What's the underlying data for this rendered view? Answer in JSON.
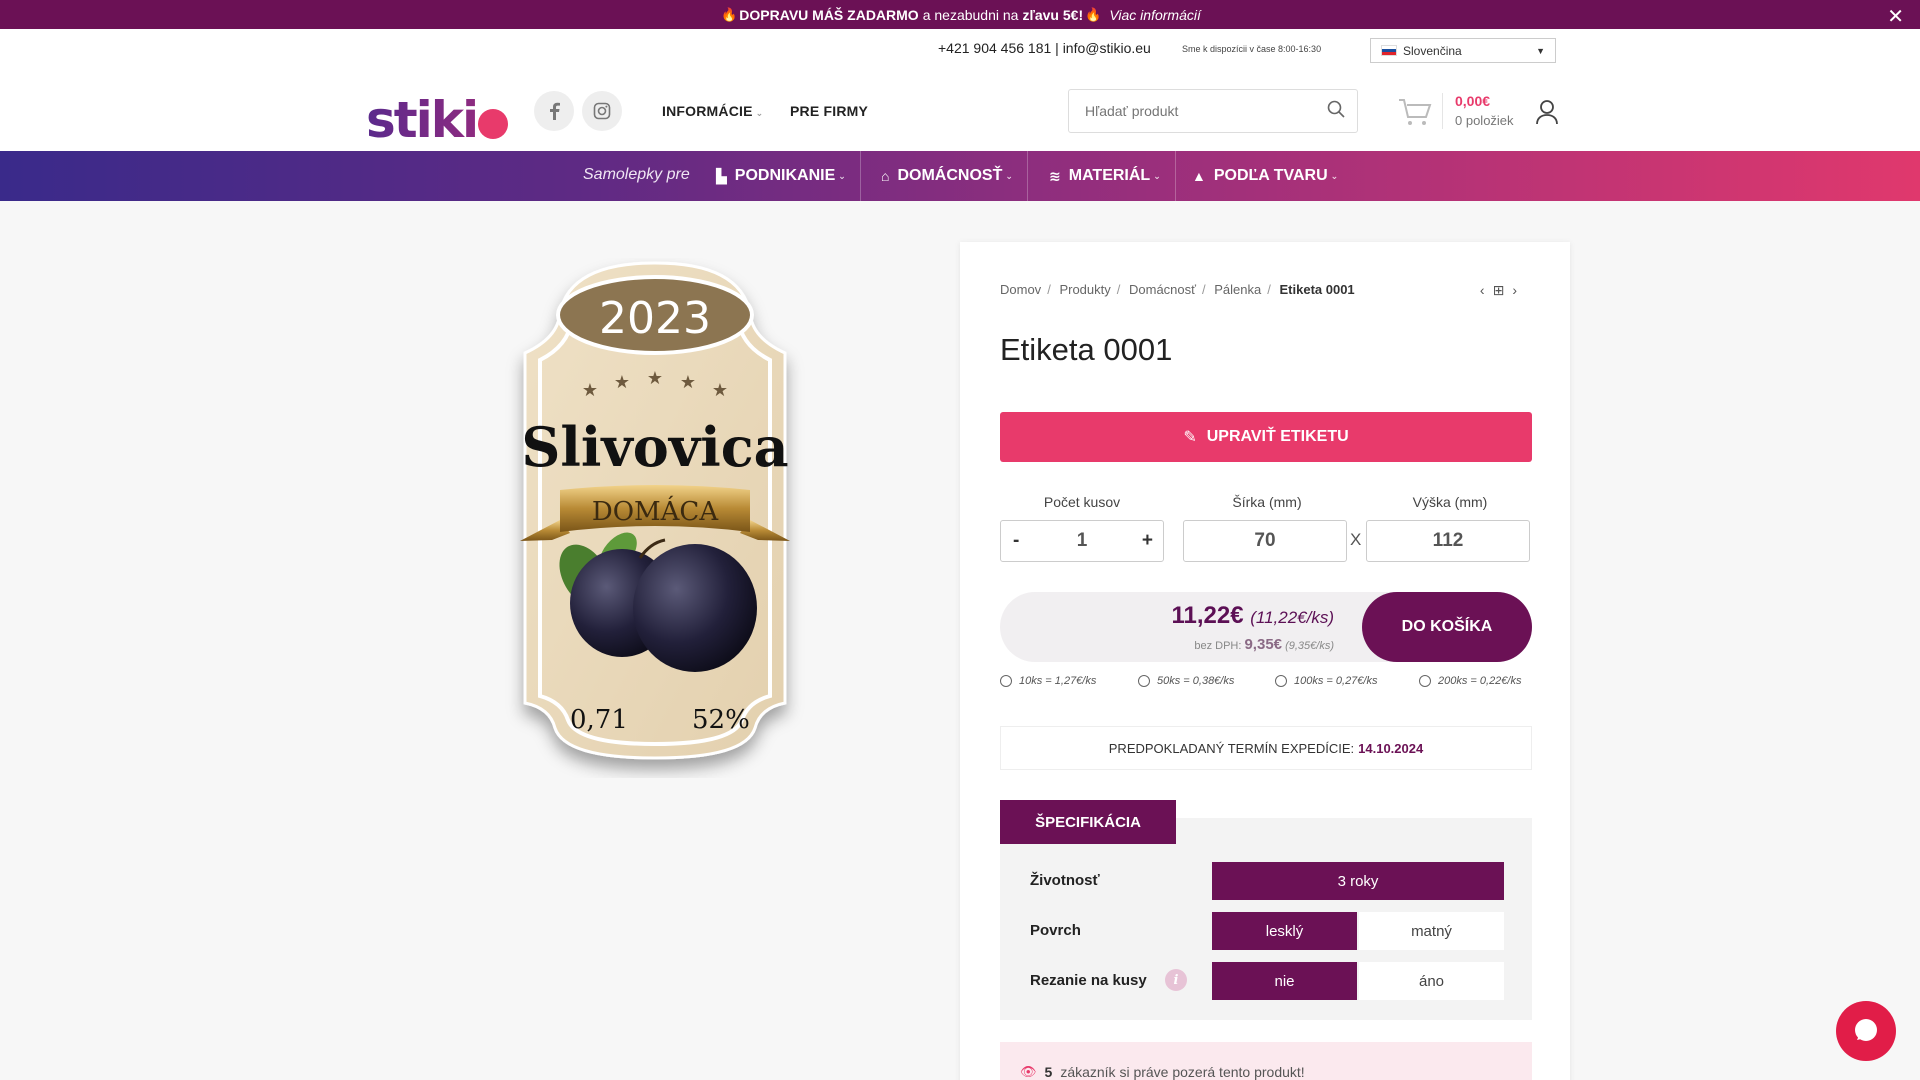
{
  "promo": {
    "bold_text": "DOPRAVU MÁŠ ZADARMO",
    "middle_text": "a nezabudni na",
    "bold_discount": "zľavu 5€!",
    "more_link": "Viac informácií",
    "close_symbol": "✕"
  },
  "header": {
    "contact": "+421 904 456 181 | info@stikio.eu",
    "hours": "Sme k dispozícii v čase 8:00-16:30",
    "language": "Slovenčina",
    "logo": "stiki",
    "nav": [
      {
        "label": "INFORMÁCIE"
      },
      {
        "label": "PRE FIRMY"
      }
    ],
    "search_placeholder": "Hľadať produkt",
    "cart_total": "0,00€",
    "cart_count": "0 položiek"
  },
  "categories": {
    "intro": "Samolepky pre",
    "items": [
      {
        "label": "PODNIKANIE",
        "icon": "factory-icon"
      },
      {
        "label": "DOMÁCNOSŤ",
        "icon": "home-icon"
      },
      {
        "label": "MATERIÁL",
        "icon": "layers-icon"
      },
      {
        "label": "PODĽA TVARU",
        "icon": "shapes-icon"
      }
    ]
  },
  "label_image": {
    "year": "2023",
    "name": "Slivovica",
    "ribbon": "DOMÁCA",
    "volume": "0,71",
    "percent": "52%"
  },
  "product": {
    "breadcrumbs": [
      "Domov",
      "Produkty",
      "Domácnosť",
      "Pálenka",
      "Etiketa 0001"
    ],
    "title": "Etiketa 0001",
    "edit_button": "UPRAVIŤ ETIKETU",
    "qty_label": "Počet kusov",
    "qty_minus": "-",
    "qty_plus": "+",
    "qty_value": "1",
    "width_label": "Šírka (mm)",
    "width_value": "70",
    "height_label": "Výška (mm)",
    "height_value": "112",
    "dim_separator": "X",
    "price": "11,22€",
    "price_per": "(11,22€/ks)",
    "price_net_label": "bez DPH:",
    "price_net": "9,35€",
    "price_net_per": "(9,35€/ks)",
    "add_to_cart": "DO KOŠÍKA",
    "tiers": [
      "10ks = 1,27€/ks",
      "50ks = 0,38€/ks",
      "100ks = 0,27€/ks",
      "200ks = 0,22€/ks"
    ],
    "shipping_label": "PREDPOKLADANÝ TERMÍN EXPEDÍCIE:",
    "shipping_date": "14.10.2024",
    "spec_tab": "ŠPECIFIKÁCIA",
    "spec": {
      "life_label": "Životnosť",
      "life_value": "3 roky",
      "surface_label": "Povrch",
      "surface_opt1": "lesklý",
      "surface_opt2": "matný",
      "cut_label": "Rezanie na kusy",
      "cut_opt1": "nie",
      "cut_opt2": "áno"
    },
    "viewers_count": "5",
    "viewers_text": "zákazník si práve pozerá tento produkt!"
  },
  "colors": {
    "brand_purple": "#6b1155",
    "brand_pink": "#e83a6b"
  }
}
